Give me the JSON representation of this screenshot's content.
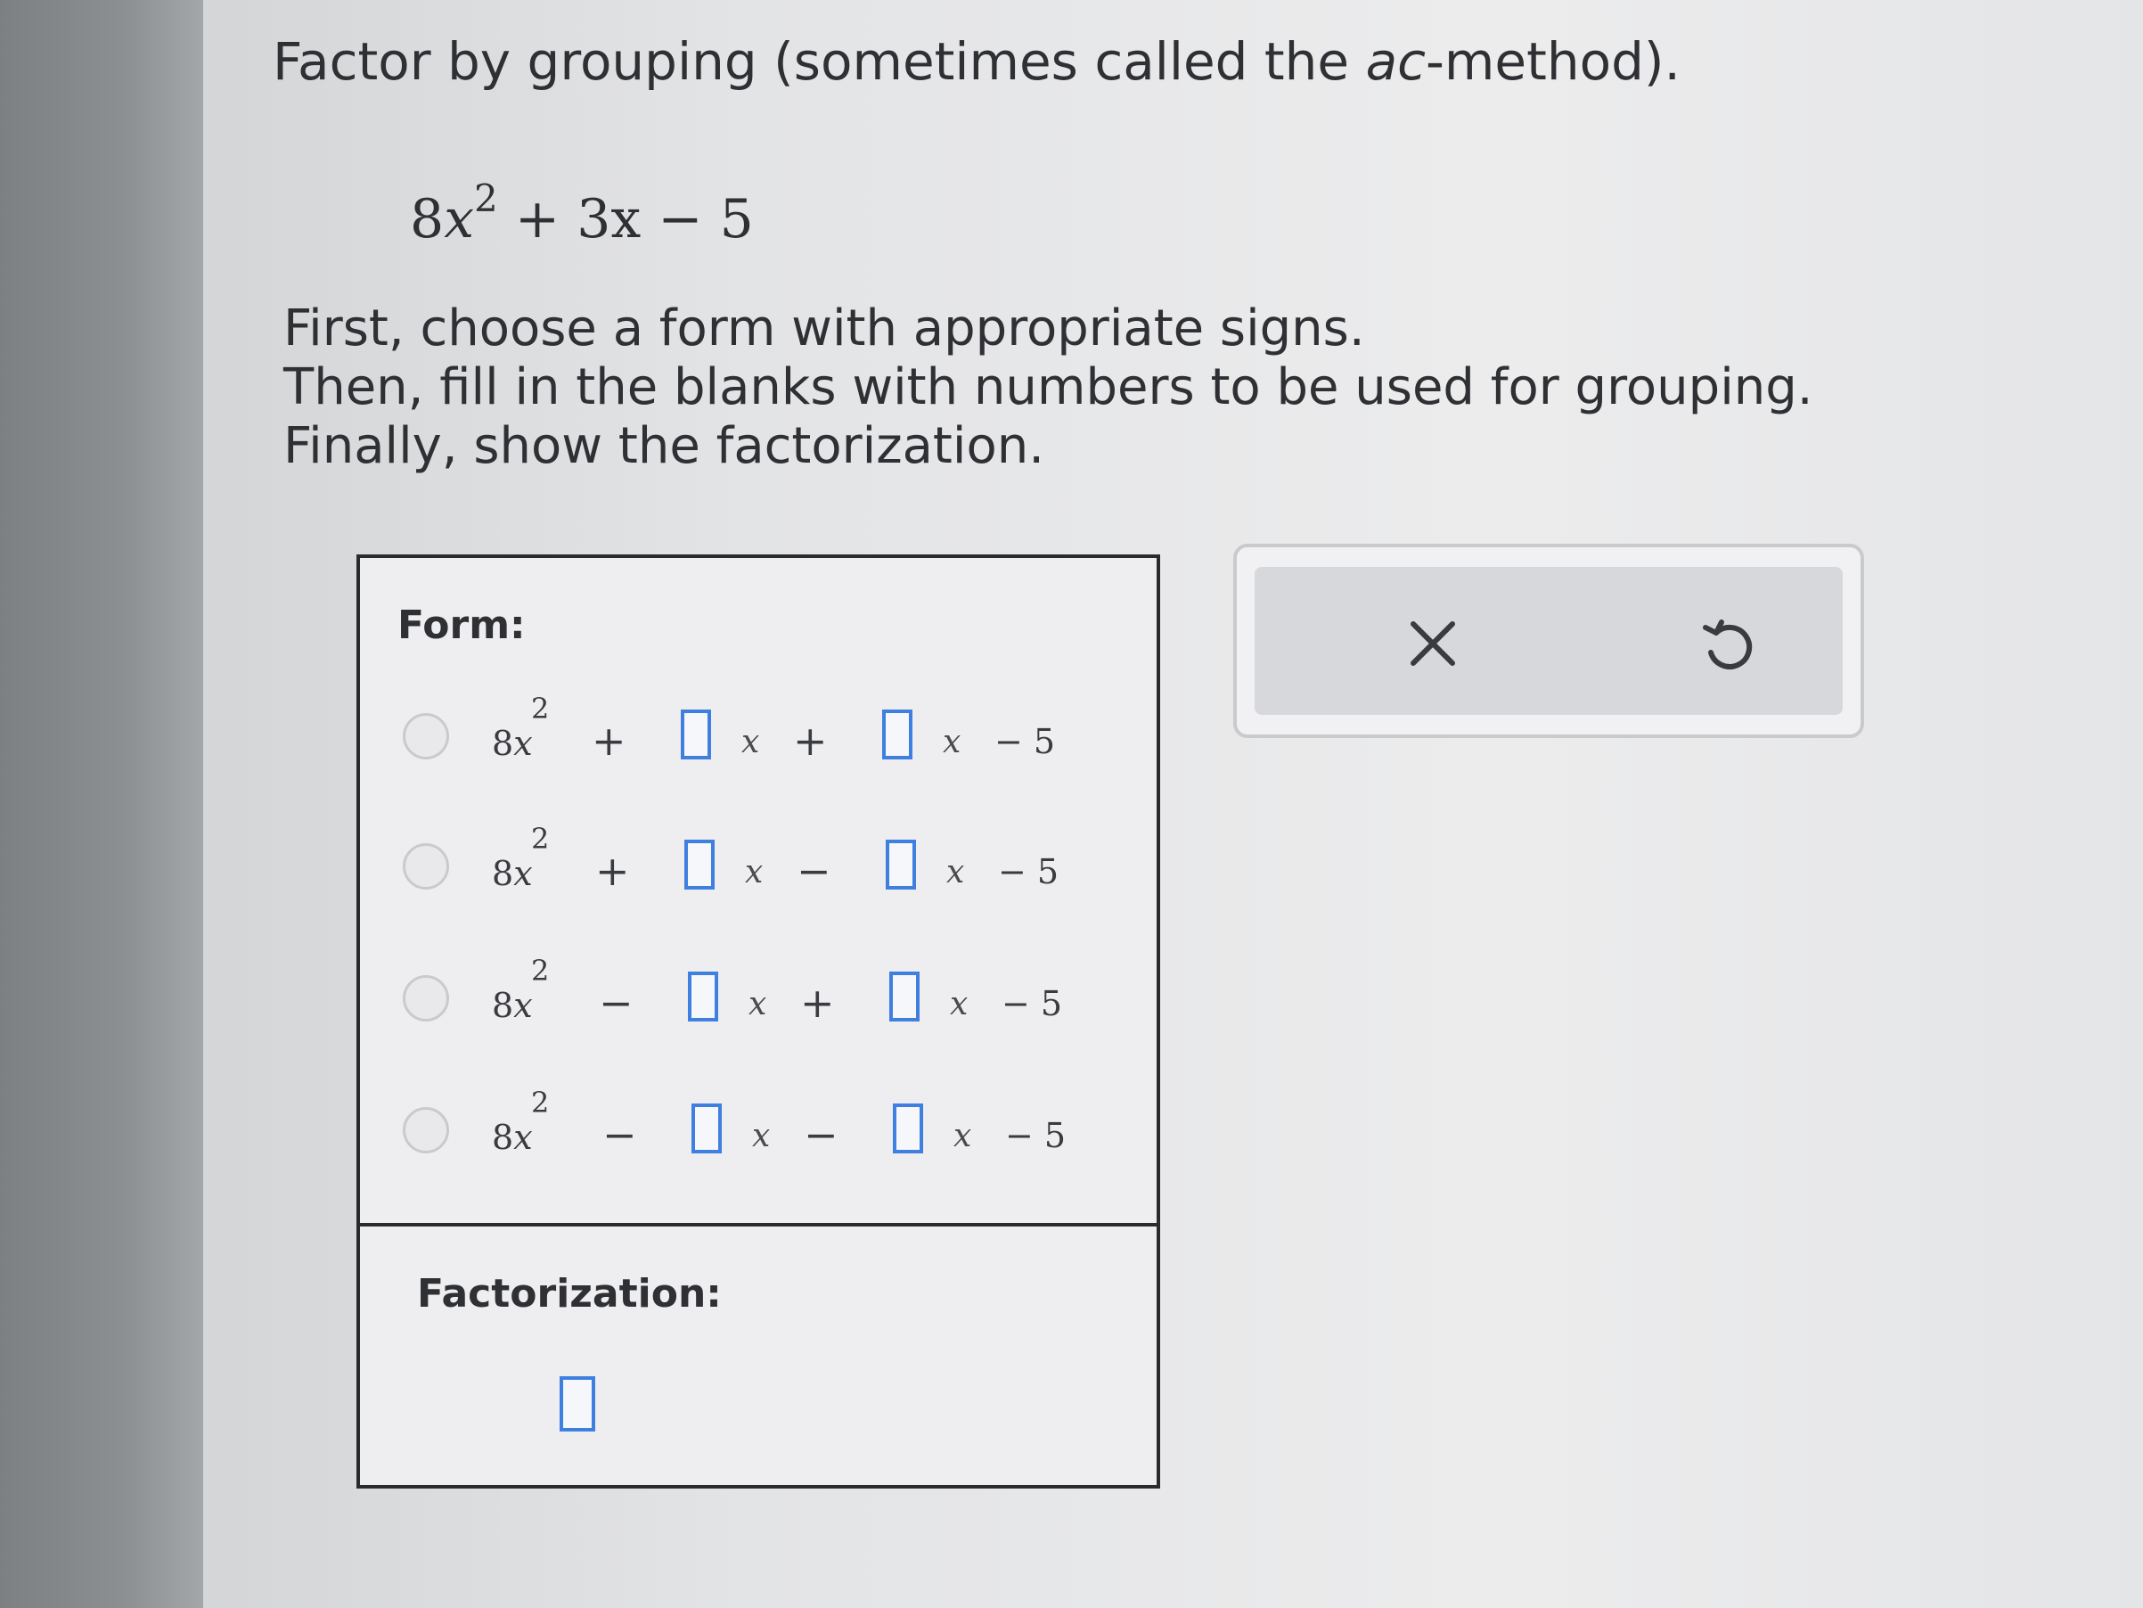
{
  "question": {
    "title_prefix": "Factor by grouping (sometimes called the ",
    "title_italic": "ac",
    "title_suffix": "-method).",
    "expression": {
      "coef": "8",
      "var": "x",
      "exp": "2",
      "rest": "+ 3x − 5"
    },
    "instructions": [
      "First, choose a form with appropriate signs.",
      "Then, fill in the blanks with numbers to be used for grouping.",
      "Finally, show the factorization."
    ]
  },
  "form_section": {
    "label": "Form:",
    "options": [
      {
        "lead": "8",
        "var": "x",
        "exp": "2",
        "sign1": "+",
        "x1": "x",
        "sign2": "+",
        "x2": "x",
        "tail": "− 5"
      },
      {
        "lead": "8",
        "var": "x",
        "exp": "2",
        "sign1": "+",
        "x1": "x",
        "sign2": "−",
        "x2": "x",
        "tail": "− 5"
      },
      {
        "lead": "8",
        "var": "x",
        "exp": "2",
        "sign1": "−",
        "x1": "x",
        "sign2": "+",
        "x2": "x",
        "tail": "− 5"
      },
      {
        "lead": "8",
        "var": "x",
        "exp": "2",
        "sign1": "−",
        "x1": "x",
        "sign2": "−",
        "x2": "x",
        "tail": "− 5"
      }
    ]
  },
  "factorization_section": {
    "label": "Factorization:"
  },
  "actions": {
    "clear_icon": "close-icon",
    "undo_icon": "undo-icon"
  },
  "colors": {
    "blank_border": "#3f7fe0",
    "text": "#2f3033"
  }
}
